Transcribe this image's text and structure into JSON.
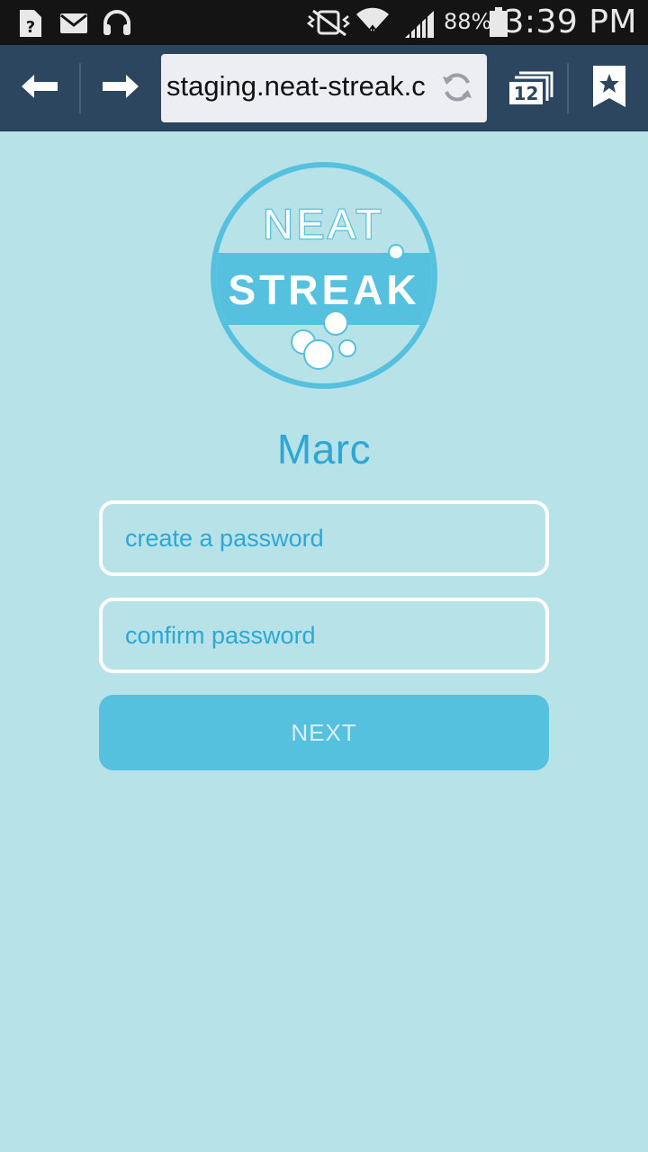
{
  "status_bar": {
    "battery_percent": "88%",
    "time": "3:39 PM",
    "icons": [
      "unknown-sim-icon",
      "mail-icon",
      "headphones-icon",
      "vibrate-mute-icon",
      "wifi-icon",
      "signal-icon",
      "battery-icon"
    ]
  },
  "browser": {
    "url": "staging.neat-streak.c",
    "tab_count": "12"
  },
  "logo": {
    "line1": "NEAT",
    "line2": "STREAK"
  },
  "form": {
    "name": "Marc",
    "password_placeholder": "create a password",
    "confirm_placeholder": "confirm password",
    "next_label": "NEXT"
  },
  "colors": {
    "page_bg": "#b6e2e8",
    "accent": "#2ea7d6",
    "button_bg": "#56c1df",
    "toolbar_bg": "#2d4660"
  }
}
